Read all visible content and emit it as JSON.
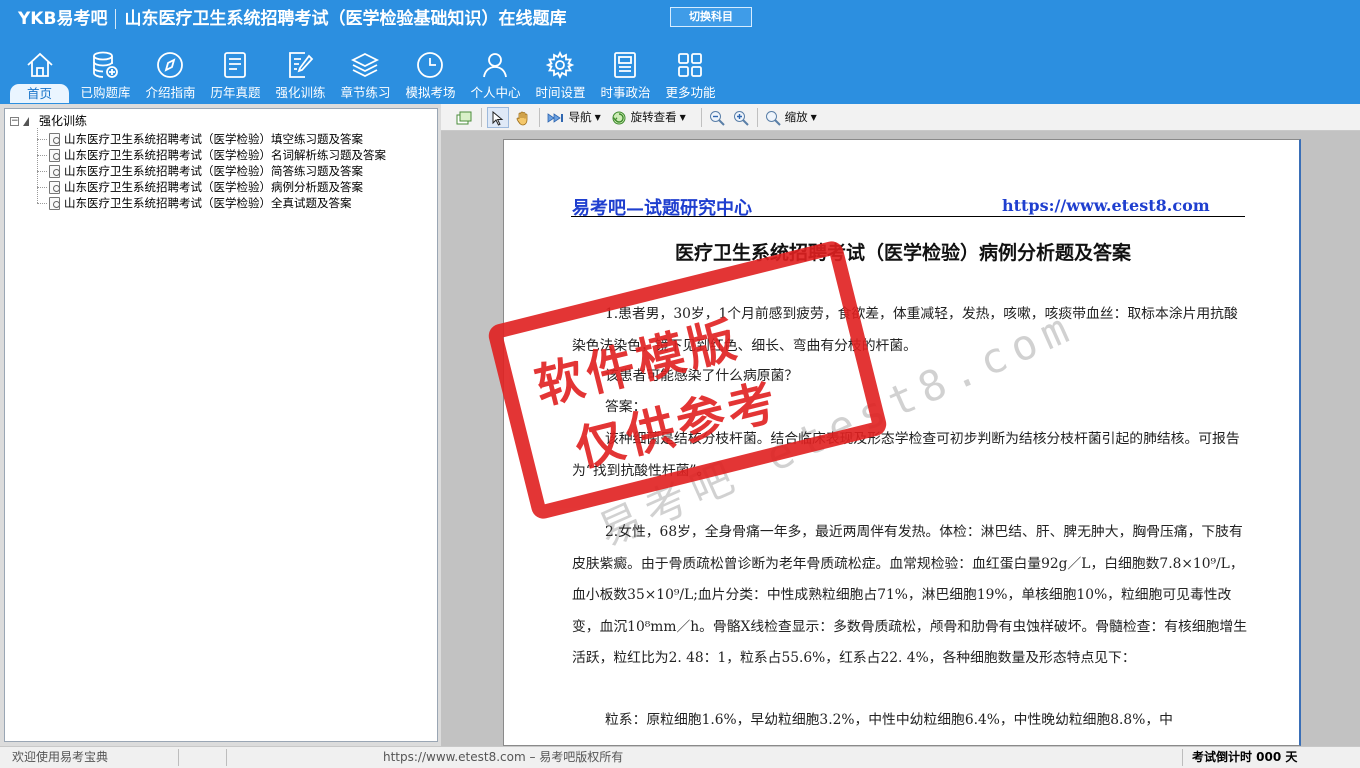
{
  "header": {
    "logo": "YKB易考吧",
    "title": "山东医疗卫生系统招聘考试（医学检验基础知识）在线题库",
    "switch_label": "切换科目",
    "colors": {
      "bar": "#2c8fe0",
      "active_tab": "#eaf5ff"
    }
  },
  "nav": [
    {
      "label": "首页",
      "icon": "home-icon",
      "active": true
    },
    {
      "label": "已购题库",
      "icon": "database-add-icon"
    },
    {
      "label": "介绍指南",
      "icon": "compass-icon"
    },
    {
      "label": "历年真题",
      "icon": "list-document-icon"
    },
    {
      "label": "强化训练",
      "icon": "edit-document-icon"
    },
    {
      "label": "章节练习",
      "icon": "layers-icon"
    },
    {
      "label": "模拟考场",
      "icon": "clock-icon"
    },
    {
      "label": "个人中心",
      "icon": "user-icon"
    },
    {
      "label": "时间设置",
      "icon": "gear-icon"
    },
    {
      "label": "时事政治",
      "icon": "newspaper-icon"
    },
    {
      "label": "更多功能",
      "icon": "grid-icon"
    }
  ],
  "tree": {
    "root_label": "强化训练",
    "items": [
      "山东医疗卫生系统招聘考试（医学检验）填空练习题及答案",
      "山东医疗卫生系统招聘考试（医学检验）名词解析练习题及答案",
      "山东医疗卫生系统招聘考试（医学检验）简答练习题及答案",
      "山东医疗卫生系统招聘考试（医学检验）病例分析题及答案",
      "山东医疗卫生系统招聘考试（医学检验）全真试题及答案"
    ]
  },
  "toolbar": {
    "nav_label": "导航",
    "rotate_label": "旋转查看",
    "zoom_label": "缩放"
  },
  "document": {
    "site_name": "易考吧—试题研究中心",
    "site_url": "https://www.etest8.com",
    "title": "医疗卫生系统招聘考试（医学检验）病例分析题及答案",
    "q1_text": "1.患者男，30岁，1个月前感到疲劳，食欲差，体重减轻，发热，咳嗽，咳痰带血丝：取标本涂片用抗酸染色法染色，镜下见到红色、细长、弯曲有分枝的杆菌。",
    "q1_question": "该患者可能感染了什么病原菌？",
    "q1_answer_label": "答案：",
    "q1_answer": "该种细菌是结核分枝杆菌。结合临床表现及形态学检查可初步判断为结核分枝杆菌引起的肺结核。可报告为“找到抗酸性杆菌”。",
    "q2_text": "2.女性，68岁，全身骨痛一年多，最近两周伴有发热。体检：淋巴结、肝、脾无肿大，胸骨压痛，下肢有皮肤紫癜。由于骨质疏松曾诊断为老年骨质疏松症。血常规检验：血红蛋白量92g／L，白细胞数7.8×10⁹/L，血小板数35×10⁹/L;血片分类：中性成熟粒细胞占71%，淋巴细胞19%，单核细胞10%，粒细胞可见毒性改变，血沉10⁸mm／h。骨骼X线检查显示：多数骨质疏松，颅骨和肋骨有虫蚀样破坏。骨髓检查：有核细胞增生活跃，粒红比为2. 48：1，粒系占55.6%，红系占22. 4%，各种细胞数量及形态特点见下：",
    "q2_cells": "粒系：原粒细胞1.6%，早幼粒细胞3.2%，中性中幼粒细胞6.4%，中性晚幼粒细胞8.8%，中"
  },
  "watermark": {
    "stamp_line1": "软件模版",
    "stamp_line2": "仅供参考",
    "site_text": "易考吧 etest8.com",
    "color": "#e02020"
  },
  "status": {
    "welcome": "欢迎使用易考宝典",
    "copyright": "https://www.etest8.com – 易考吧版权所有",
    "countdown": "考试倒计时 000 天"
  }
}
